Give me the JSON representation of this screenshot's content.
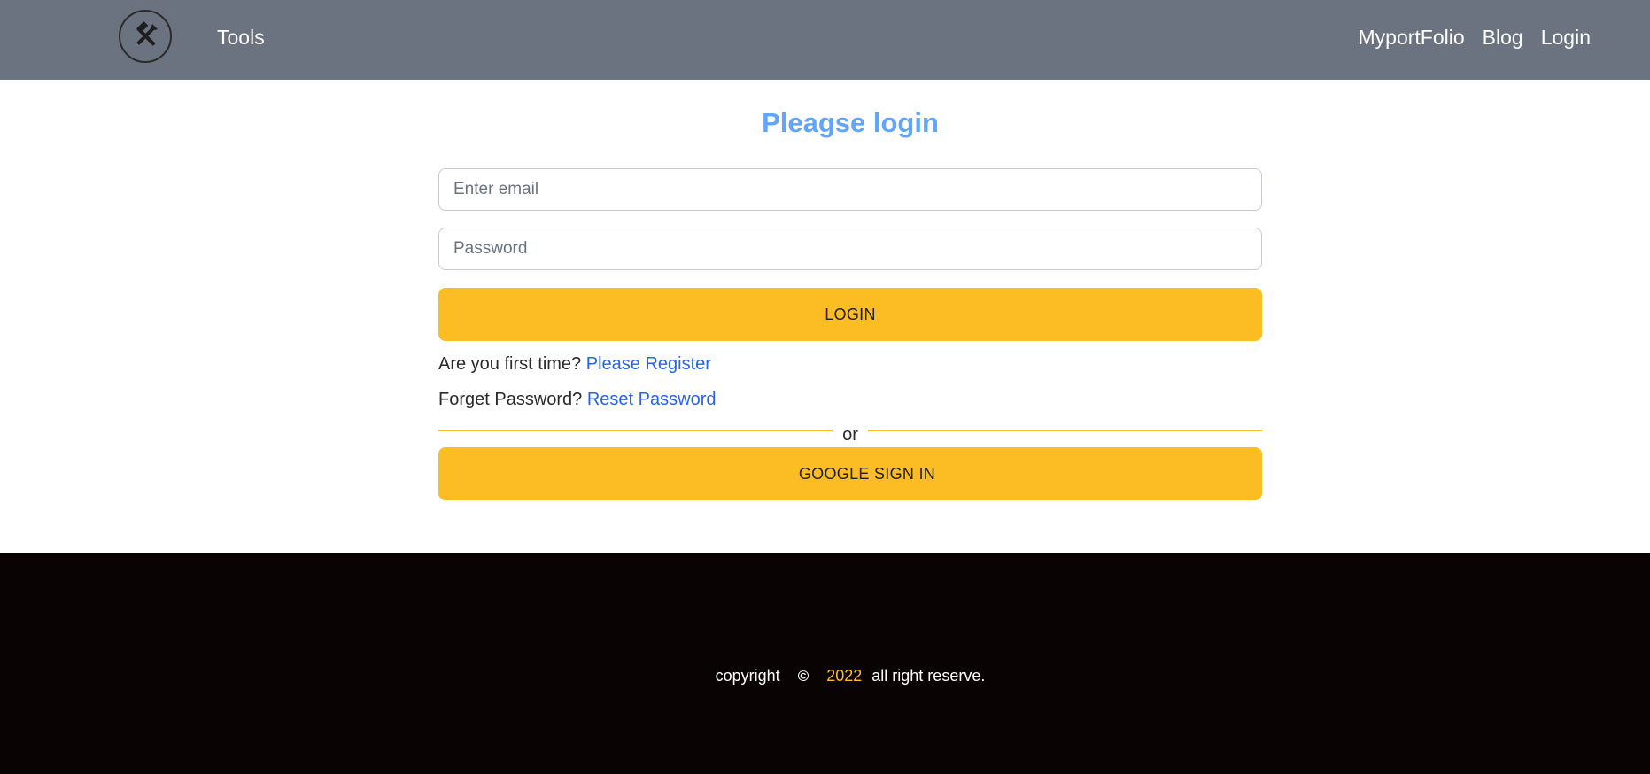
{
  "navbar": {
    "logo_icon": "tools-icon",
    "brand": "Tools",
    "links": [
      "MyportFolio",
      "Blog",
      "Login"
    ]
  },
  "title": "Pleagse login",
  "form": {
    "email_placeholder": "Enter email",
    "password_placeholder": "Password",
    "login_button": "LOGIN",
    "register_prompt": "Are you first time?",
    "register_link": "Please Register",
    "reset_prompt": "Forget Password?",
    "reset_link": "Reset Password",
    "divider_text": "or",
    "google_button": "GOOGLE SIGN IN"
  },
  "footer": {
    "copyright_label": "copyright",
    "copyright_symbol": "©",
    "year": "2022",
    "rights": "all right reserve."
  },
  "colors": {
    "navbar_bg": "#6b7280",
    "accent": "#fbbd23",
    "title": "#60a5fa",
    "link": "#2563eb",
    "footer_bg": "#0a0304"
  }
}
